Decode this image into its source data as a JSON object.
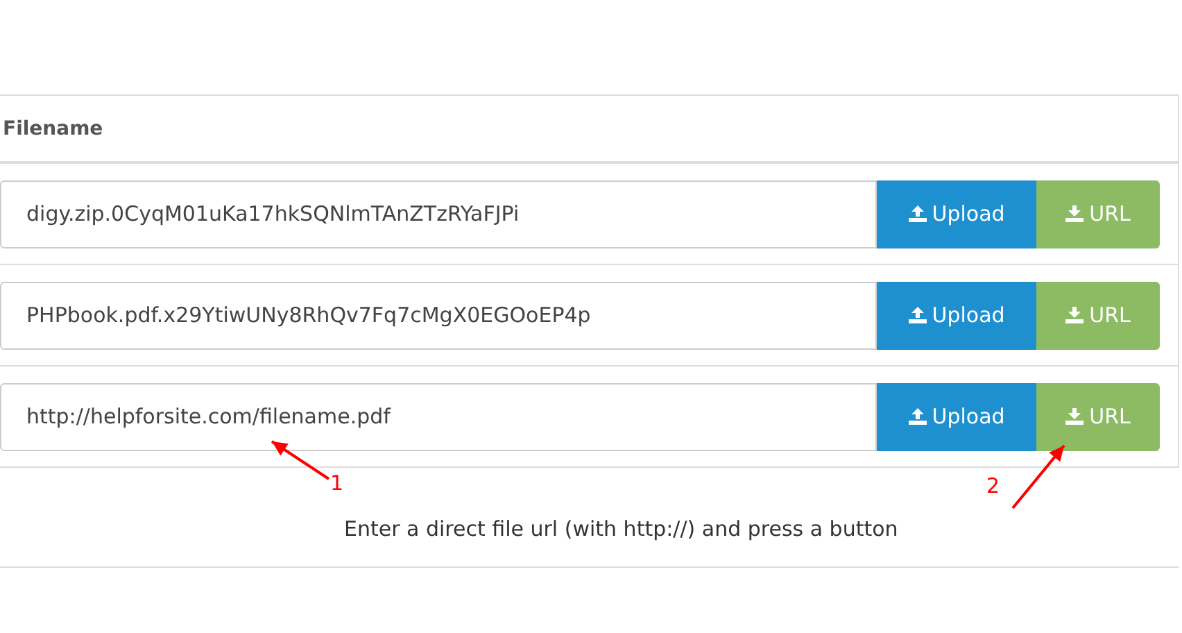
{
  "table": {
    "columns": [
      "Filename"
    ],
    "rows": [
      {
        "value": "digy.zip.0CyqM01uKa17hkSQNlmTAnZTzRYaFJPi",
        "upload": "Upload",
        "url": "URL"
      },
      {
        "value": "PHPbook.pdf.x29YtiwUNy8RhQv7Fq7cMgX0EGOoEP4p",
        "upload": "Upload",
        "url": "URL"
      },
      {
        "value": "http://helpforsite.com/filename.pdf",
        "upload": "Upload",
        "url": "URL"
      }
    ]
  },
  "note": "Enter a direct file url (with http://) and press a button",
  "annotations": [
    {
      "label": "1"
    },
    {
      "label": "2"
    }
  ]
}
